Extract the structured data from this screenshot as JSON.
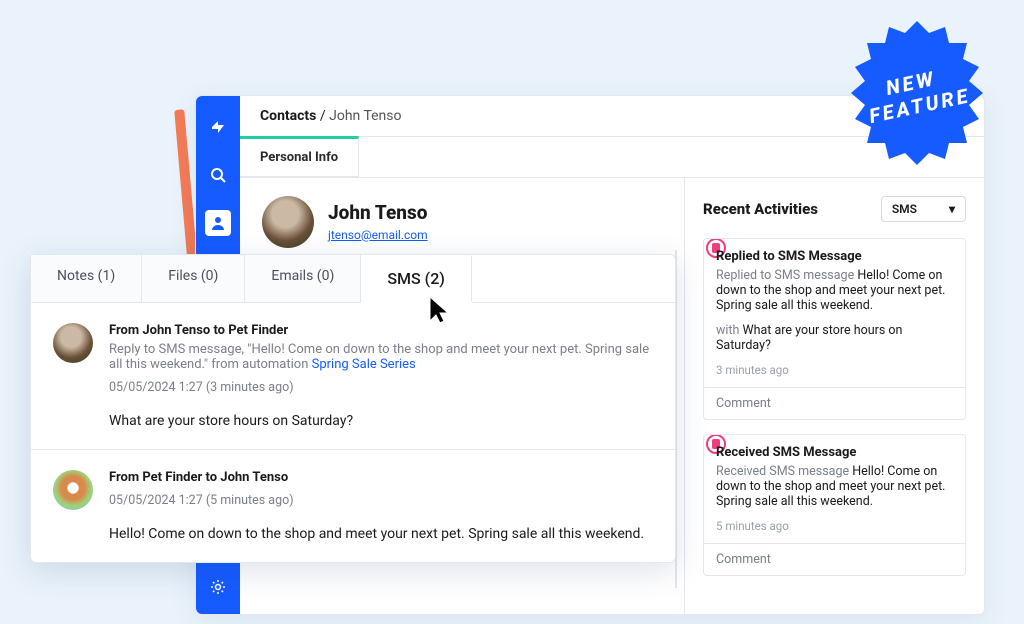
{
  "badge": {
    "line1": "NEW",
    "line2": "FEATURE"
  },
  "breadcrumb": {
    "section": "Contacts",
    "name": "John Tenso"
  },
  "subtab": {
    "label": "Personal Info"
  },
  "contact": {
    "name": "John Tenso",
    "email": "jtenso@email.com"
  },
  "tabs": [
    {
      "label": "Notes (1)"
    },
    {
      "label": "Files (0)"
    },
    {
      "label": "Emails (0)"
    },
    {
      "label": "SMS (2)",
      "active": true
    }
  ],
  "messages": [
    {
      "from": "From John Tenso to Pet Finder",
      "meta_prefix": "Reply to SMS message, \"Hello! Come on down to the shop and meet your next pet. Spring sale all this weekend.\" from automation ",
      "meta_auto": "Spring Sale Series",
      "time": "05/05/2024 1:27 (3 minutes ago)",
      "text": "What are your store hours on Saturday?"
    },
    {
      "from": "From Pet Finder to John Tenso",
      "time": "05/05/2024 1:27 (5 minutes ago)",
      "text": "Hello! Come on down to the shop and meet your next pet. Spring sale all this weekend."
    }
  ],
  "recent": {
    "title": "Recent Activities",
    "filter": "SMS",
    "items": [
      {
        "title": "Replied to SMS Message",
        "prefix": "Replied to SMS message ",
        "msg1": "Hello! Come on down to the shop and meet your next pet. Spring sale all this weekend.",
        "with_label": "with ",
        "msg2": "What are your store hours on Saturday?",
        "time": "3 minutes ago",
        "comment": "Comment"
      },
      {
        "title": "Received SMS Message",
        "prefix": "Received SMS message ",
        "msg1": "Hello! Come on down to the shop and meet your next pet. Spring sale all this weekend.",
        "time": "5 minutes ago",
        "comment": "Comment"
      }
    ]
  }
}
